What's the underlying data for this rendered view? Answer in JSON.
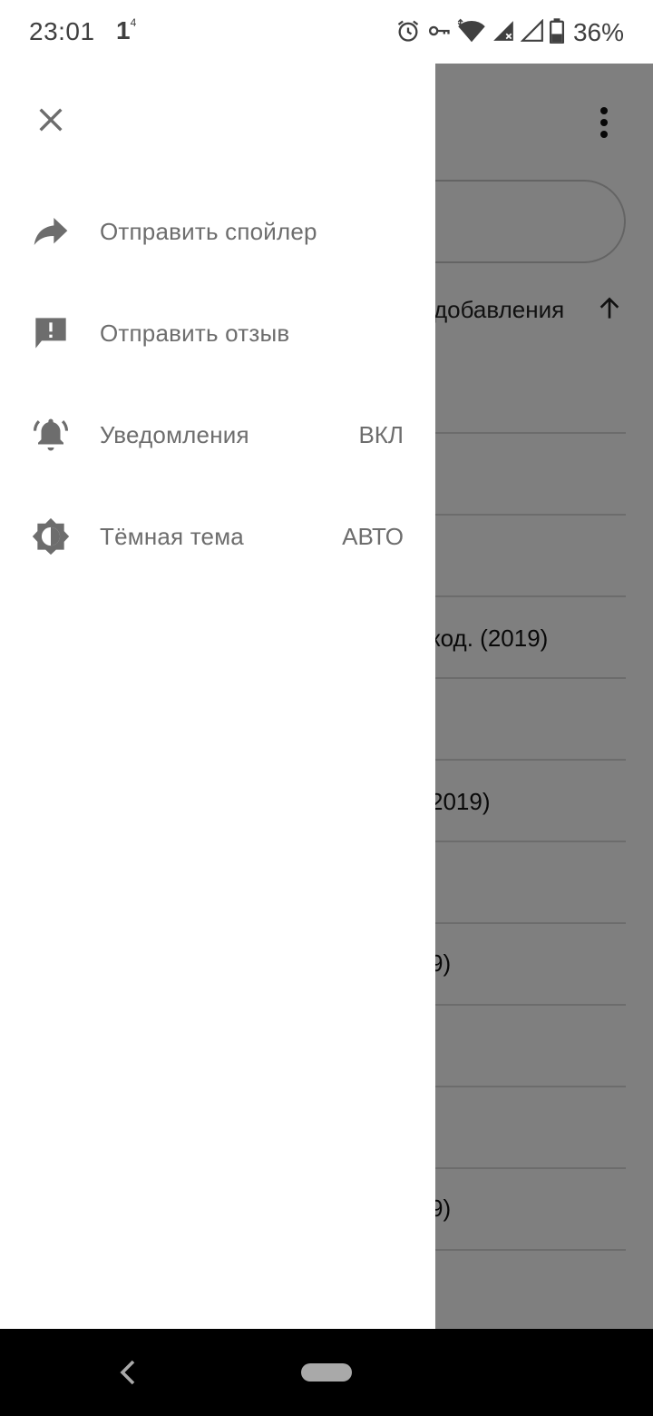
{
  "status_bar": {
    "time": "23:01",
    "sim_indicator": "1",
    "sim_sup": "4",
    "battery": "36%",
    "icons": [
      "alarm-icon",
      "vpn-key-icon",
      "wifi-icon",
      "signal-no-data-icon",
      "signal-icon",
      "battery-icon"
    ]
  },
  "background": {
    "sort_label": "добавления",
    "rows": [
      "",
      "",
      "",
      "код. (2019)",
      "",
      "2019)",
      "",
      "9)",
      "",
      "",
      "9)",
      ""
    ]
  },
  "drawer": {
    "items": [
      {
        "label": "Отправить спойлер",
        "icon": "share-forward-icon",
        "value": ""
      },
      {
        "label": "Отправить отзыв",
        "icon": "feedback-icon",
        "value": ""
      },
      {
        "label": "Уведомления",
        "icon": "notifications-active-icon",
        "value": "ВКЛ"
      },
      {
        "label": "Тёмная тема",
        "icon": "brightness-icon",
        "value": "АВТО"
      }
    ]
  },
  "colors": {
    "drawer_text": "#6d6d6d",
    "scrim": "#808080",
    "nav_bar": "#000000"
  }
}
